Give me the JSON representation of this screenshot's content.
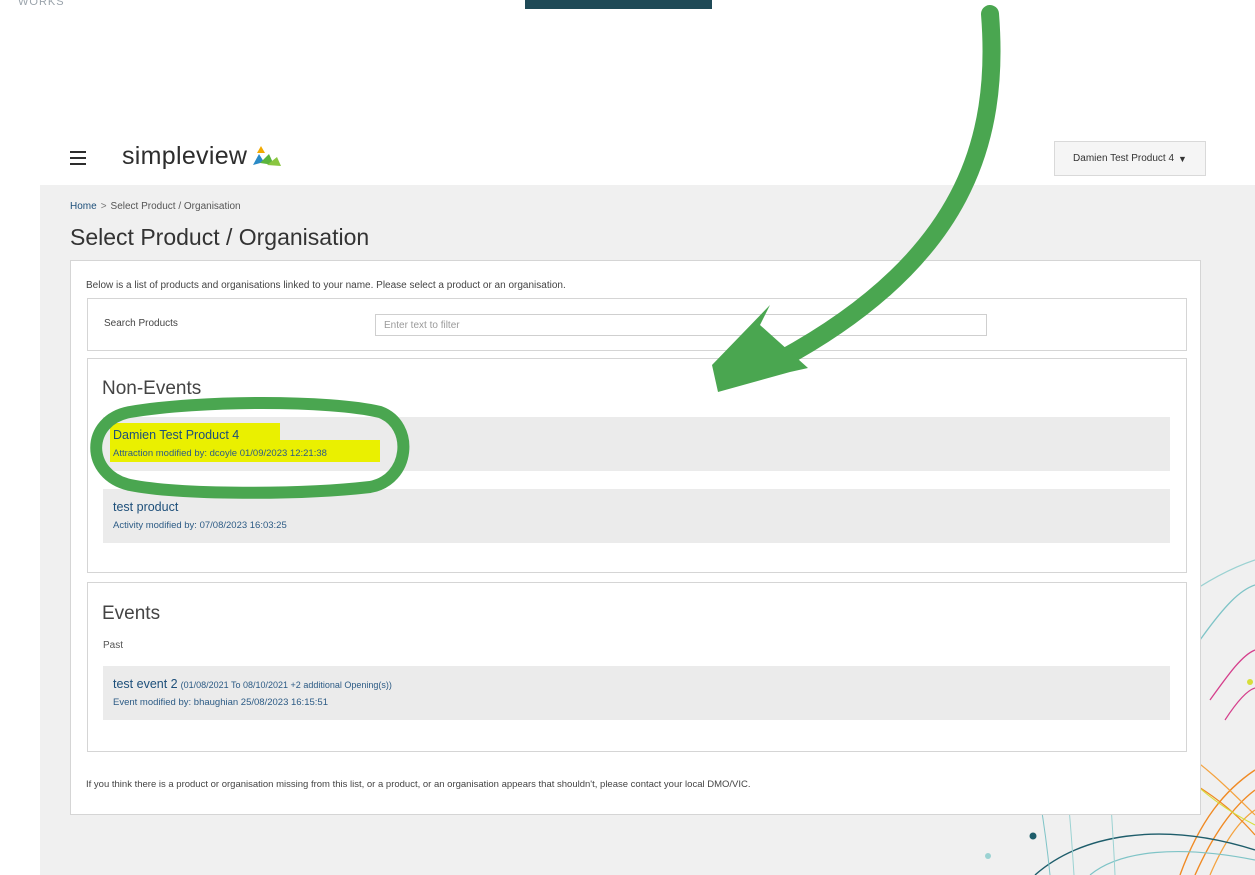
{
  "corner_text": "WORKS",
  "topbar": {
    "logo_text": "simpleview",
    "account_label": "Damien Test Product 4",
    "account_caret": "▼"
  },
  "breadcrumb": {
    "home": "Home",
    "separator": ">",
    "current": "Select Product / Organisation"
  },
  "page_title": "Select Product / Organisation",
  "intro_text": "Below is a list of products and organisations linked to your name. Please select a product or an organisation.",
  "search": {
    "label": "Search Products",
    "placeholder": "Enter text to filter",
    "value": ""
  },
  "non_events": {
    "title": "Non-Events",
    "items": [
      {
        "name": "Damien Test Product 4",
        "meta": "Attraction modified by: dcoyle 01/09/2023 12:21:38",
        "highlighted": true
      },
      {
        "name": "test product",
        "meta": "Activity modified by: 07/08/2023 16:03:25",
        "highlighted": false
      }
    ]
  },
  "events": {
    "title": "Events",
    "subtitle": "Past",
    "items": [
      {
        "name": "test event 2",
        "range": "(01/08/2021 To 08/10/2021 +2 additional Opening(s))",
        "meta": "Event modified by: bhaughian 25/08/2023 16:15:51"
      }
    ]
  },
  "footer_note": "If you think there is a product or organisation missing from this list, or a product, or an organisation appears that shouldn't, please contact your local DMO/VIC.",
  "colors": {
    "annotation_green": "#4aa650",
    "highlight_yellow": "#eaf000",
    "link_blue": "#1d4f7a"
  }
}
